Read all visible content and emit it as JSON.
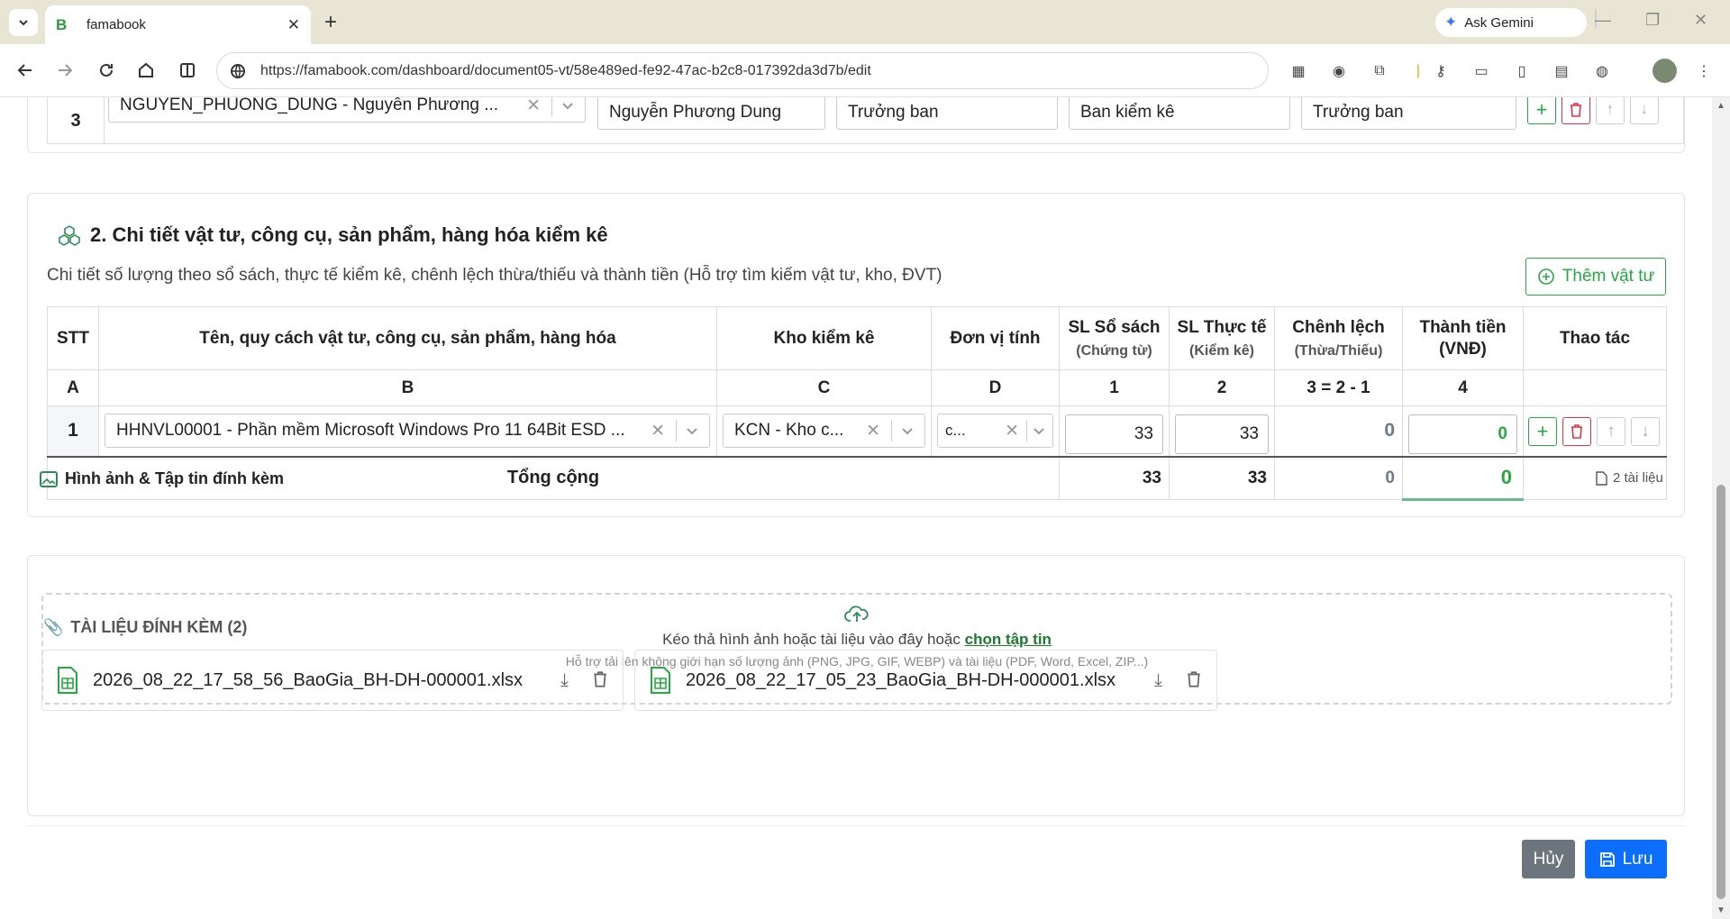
{
  "browser": {
    "tab_title": "famabook",
    "favicon_letter": "B",
    "url": "https://famabook.com/dashboard/document05-vt/58e489ed-fe92-47ac-b2c8-017392da3d7b/edit",
    "gemini_label": "Ask Gemini"
  },
  "committee": {
    "row_index": "3",
    "member_select": "NGUYEN_PHUONG_DUNG - Nguyễn Phương ...",
    "name": "Nguyễn Phương Dung",
    "position": "Trưởng ban",
    "board": "Ban kiểm kê",
    "role": "Trưởng ban"
  },
  "section2": {
    "title": "2. Chi tiết vật tư, công cụ, sản phẩm, hàng hóa kiểm kê",
    "subtitle": "Chi tiết số lượng theo sổ sách, thực tế kiểm kê, chênh lệch thừa/thiếu và thành tiền (Hỗ trợ tìm kiếm vật tư, kho, ĐVT)",
    "add_button": "Thêm vật tư",
    "headers": {
      "stt": "STT",
      "name": "Tên, quy cách vật tư, công cụ, sản phẩm, hàng hóa",
      "warehouse": "Kho kiểm kê",
      "unit": "Đơn vị tính",
      "book_qty": "SL Sổ sách",
      "book_qty_sub": "(Chứng từ)",
      "actual_qty": "SL Thực tế",
      "actual_qty_sub": "(Kiểm kê)",
      "diff": "Chênh lệch",
      "diff_sub": "(Thừa/Thiếu)",
      "amount": "Thành tiền",
      "amount_sub": "(VNĐ)",
      "actions": "Thao tác"
    },
    "codes": [
      "A",
      "B",
      "C",
      "D",
      "1",
      "2",
      "3 = 2 - 1",
      "4",
      ""
    ],
    "row": {
      "stt": "1",
      "item": "HHNVL00001 - Phần mềm Microsoft Windows Pro 11 64Bit ESD ...",
      "warehouse": "KCN - Kho c...",
      "unit": "c...",
      "book_qty": "33",
      "actual_qty": "33",
      "diff": "0",
      "amount": "0"
    },
    "total": {
      "label": "Tổng cộng",
      "book_qty": "33",
      "actual_qty": "33",
      "diff": "0",
      "amount": "0"
    }
  },
  "attachments": {
    "title": "Hình ảnh & Tập tin đính kèm",
    "count_label": "2 tài liệu",
    "drop_text": "Kéo thả hình ảnh hoặc tài liệu vào đây hoặc",
    "drop_link": "chọn tập tin",
    "drop_hint": "Hỗ trợ tải lên không giới hạn số lượng ảnh (PNG, JPG, GIF, WEBP) và tài liệu (PDF, Word, Excel, ZIP...)",
    "list_title": "TÀI LIỆU ĐÍNH KÈM (2)",
    "files": [
      {
        "name": "2026_08_22_17_58_56_BaoGia_BH-DH-000001.xlsx"
      },
      {
        "name": "2026_08_22_17_05_23_BaoGia_BH-DH-000001.xlsx"
      }
    ]
  },
  "footer": {
    "cancel": "Hủy",
    "save": "Lưu"
  },
  "colors": {
    "accent_green": "#28a745",
    "danger": "#dc3545",
    "primary": "#0d6efd",
    "secondary": "#6c757d"
  }
}
